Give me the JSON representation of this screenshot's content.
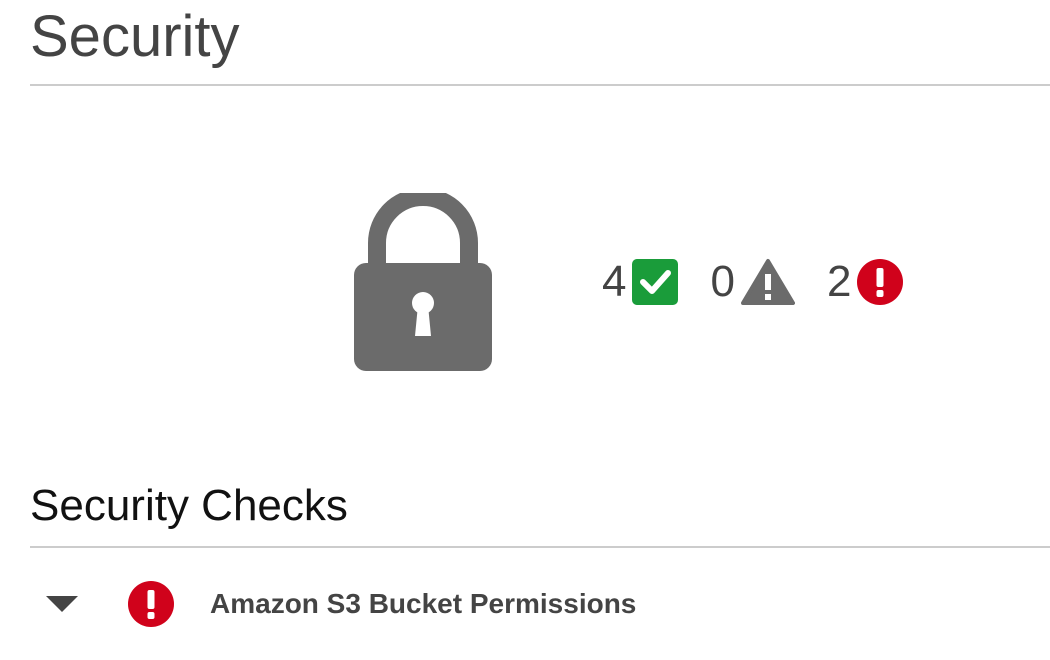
{
  "page": {
    "title": "Security"
  },
  "summary": {
    "icon": "lock-icon",
    "passed": {
      "count": "4",
      "icon": "check-icon",
      "color": "#1a9c3a"
    },
    "warnings": {
      "count": "0",
      "icon": "warning-icon",
      "color": "#6b6b6b"
    },
    "errors": {
      "count": "2",
      "icon": "error-icon",
      "color": "#d0021b"
    }
  },
  "checks_section": {
    "title": "Security Checks",
    "items": [
      {
        "label": "Amazon S3 Bucket Permissions",
        "status_icon": "error-icon",
        "expanded": true
      }
    ]
  }
}
